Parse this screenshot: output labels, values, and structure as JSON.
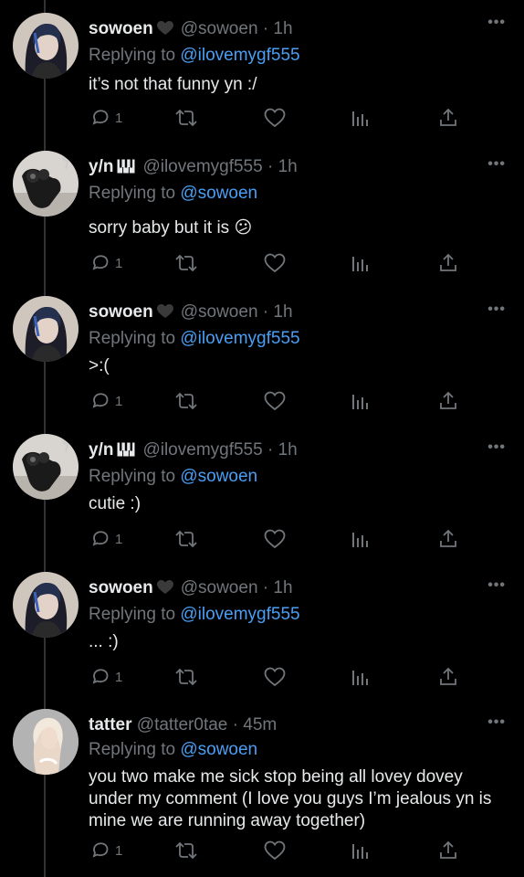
{
  "replying_prefix": "Replying to",
  "tweets": [
    {
      "name": "sowoen",
      "badge_icon": "black-heart-icon",
      "handle": "@sowoen",
      "dot": "·",
      "time": "1h",
      "replying_to": "@ilovemygf555",
      "text": "it’s not that funny yn :/",
      "reply_count": "1",
      "avatar": "sowoen"
    },
    {
      "name": "y/n",
      "badge_icon": "piano-keys-icon",
      "handle": "@ilovemygf555",
      "dot": "·",
      "time": "1h",
      "replying_to": "@sowoen",
      "text": "sorry baby but it is 😕",
      "reply_count": "1",
      "avatar": "yn"
    },
    {
      "name": "sowoen",
      "badge_icon": "black-heart-icon",
      "handle": "@sowoen",
      "dot": "·",
      "time": "1h",
      "replying_to": "@ilovemygf555",
      "text": ">:(",
      "reply_count": "1",
      "avatar": "sowoen"
    },
    {
      "name": "y/n",
      "badge_icon": "piano-keys-icon",
      "handle": "@ilovemygf555",
      "dot": "·",
      "time": "1h",
      "replying_to": "@sowoen",
      "text": "cutie :)",
      "reply_count": "1",
      "avatar": "yn"
    },
    {
      "name": "sowoen",
      "badge_icon": "black-heart-icon",
      "handle": "@sowoen",
      "dot": "·",
      "time": "1h",
      "replying_to": "@ilovemygf555",
      "text": "... :)",
      "reply_count": "1",
      "avatar": "sowoen"
    },
    {
      "name": "tatter",
      "badge_icon": "",
      "handle": "@tatter0tae",
      "dot": "·",
      "time": "45m",
      "replying_to": "@sowoen",
      "text": "you two make me sick stop being all lovey dovey under my comment (I love you guys I’m jealous yn is mine we are running away together)",
      "reply_count": "1",
      "avatar": "tatter"
    }
  ],
  "colors": {
    "background": "#000000",
    "text": "#e7e9ea",
    "muted": "#71767b",
    "mention": "#4a9ff5",
    "thread_line": "#2f3336"
  }
}
